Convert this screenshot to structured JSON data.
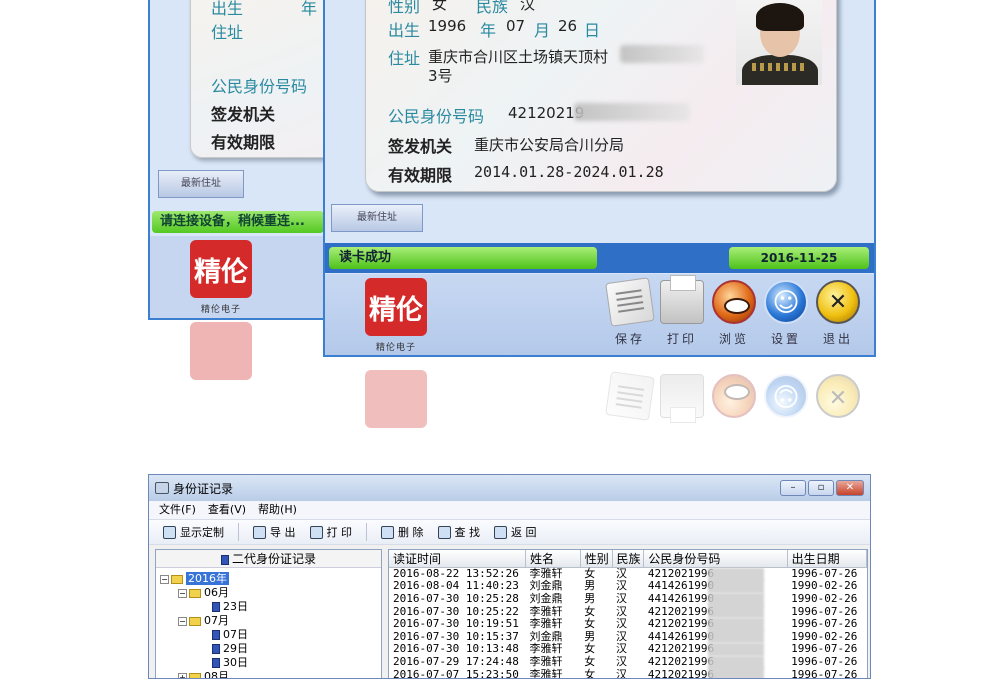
{
  "back_window": {
    "labels": {
      "birth_partial": "出生",
      "year_partial": "年",
      "address": "住址",
      "id_number": "公民身份号码",
      "authority": "签发机关",
      "validity": "有效期限"
    },
    "latest_address_button": "最新住址",
    "status": "请连接设备，稍候重连...",
    "logo_text": "精伦",
    "logo_caption": "精伦电子"
  },
  "front_window": {
    "card": {
      "gender_label": "性别",
      "gender_value": "女",
      "ethnicity_label": "民族",
      "ethnicity_value": "汉",
      "birth_label": "出生",
      "birth_year": "1996",
      "year_unit": "年",
      "birth_month": "07",
      "month_unit": "月",
      "birth_day": "26",
      "day_unit": "日",
      "address_label": "住址",
      "address_line1": "重庆市合川区土场镇天顶村",
      "address_line2": "3号",
      "id_label": "公民身份号码",
      "id_value": "42120219",
      "authority_label": "签发机关",
      "authority_value": "重庆市公安局合川分局",
      "validity_label": "有效期限",
      "validity_value": "2014.01.28-2024.01.28"
    },
    "latest_address_button": "最新住址",
    "status_text": "读卡成功",
    "date_text": "2016-11-25",
    "logo_text": "精伦",
    "logo_caption": "精伦电子",
    "tools": [
      {
        "label": "保存",
        "icon": "save-icon"
      },
      {
        "label": "打印",
        "icon": "printer-icon"
      },
      {
        "label": "浏览",
        "icon": "eye-icon"
      },
      {
        "label": "设置",
        "icon": "person-icon"
      },
      {
        "label": "退出",
        "icon": "exit-icon"
      }
    ]
  },
  "dialog": {
    "title": "身份证记录",
    "menu": [
      "文件(F)",
      "查看(V)",
      "帮助(H)"
    ],
    "toolbar": {
      "display_custom": "显示定制",
      "export": "导 出",
      "print": "打 印",
      "delete": "删 除",
      "find": "查 找",
      "back": "返 回"
    },
    "tree": {
      "header": "二代身份证记录",
      "year": "2016年",
      "nodes": [
        "06月",
        "23日",
        "07月",
        "07日",
        "29日",
        "30日",
        "08月"
      ]
    },
    "table": {
      "columns": [
        "读证时间",
        "姓名",
        "性别",
        "民族",
        "公民身份号码",
        "出生日期"
      ],
      "rows": [
        [
          "2016-08-22 13:52:26",
          "李雅轩",
          "女",
          "汉",
          "4212021996",
          "1996-07-26"
        ],
        [
          "2016-08-04 11:40:23",
          "刘金鼎",
          "男",
          "汉",
          "4414261990",
          "1990-02-26"
        ],
        [
          "2016-07-30 10:25:28",
          "刘金鼎",
          "男",
          "汉",
          "4414261990",
          "1990-02-26"
        ],
        [
          "2016-07-30 10:25:22",
          "李雅轩",
          "女",
          "汉",
          "4212021996",
          "1996-07-26"
        ],
        [
          "2016-07-30 10:19:51",
          "李雅轩",
          "女",
          "汉",
          "4212021996",
          "1996-07-26"
        ],
        [
          "2016-07-30 10:15:37",
          "刘金鼎",
          "男",
          "汉",
          "4414261990",
          "1990-02-26"
        ],
        [
          "2016-07-30 10:13:48",
          "李雅轩",
          "女",
          "汉",
          "4212021996",
          "1996-07-26"
        ],
        [
          "2016-07-29 17:24:48",
          "李雅轩",
          "女",
          "汉",
          "4212021996",
          "1996-07-26"
        ],
        [
          "2016-07-07 15:23:50",
          "李雅轩",
          "女",
          "汉",
          "4212021996",
          "1996-07-26"
        ]
      ]
    }
  },
  "colors": {
    "frame_blue": "#3a7fd0",
    "status_green": "#53c921",
    "label_teal": "#2a8aa0",
    "logo_red": "#d42a2a"
  }
}
